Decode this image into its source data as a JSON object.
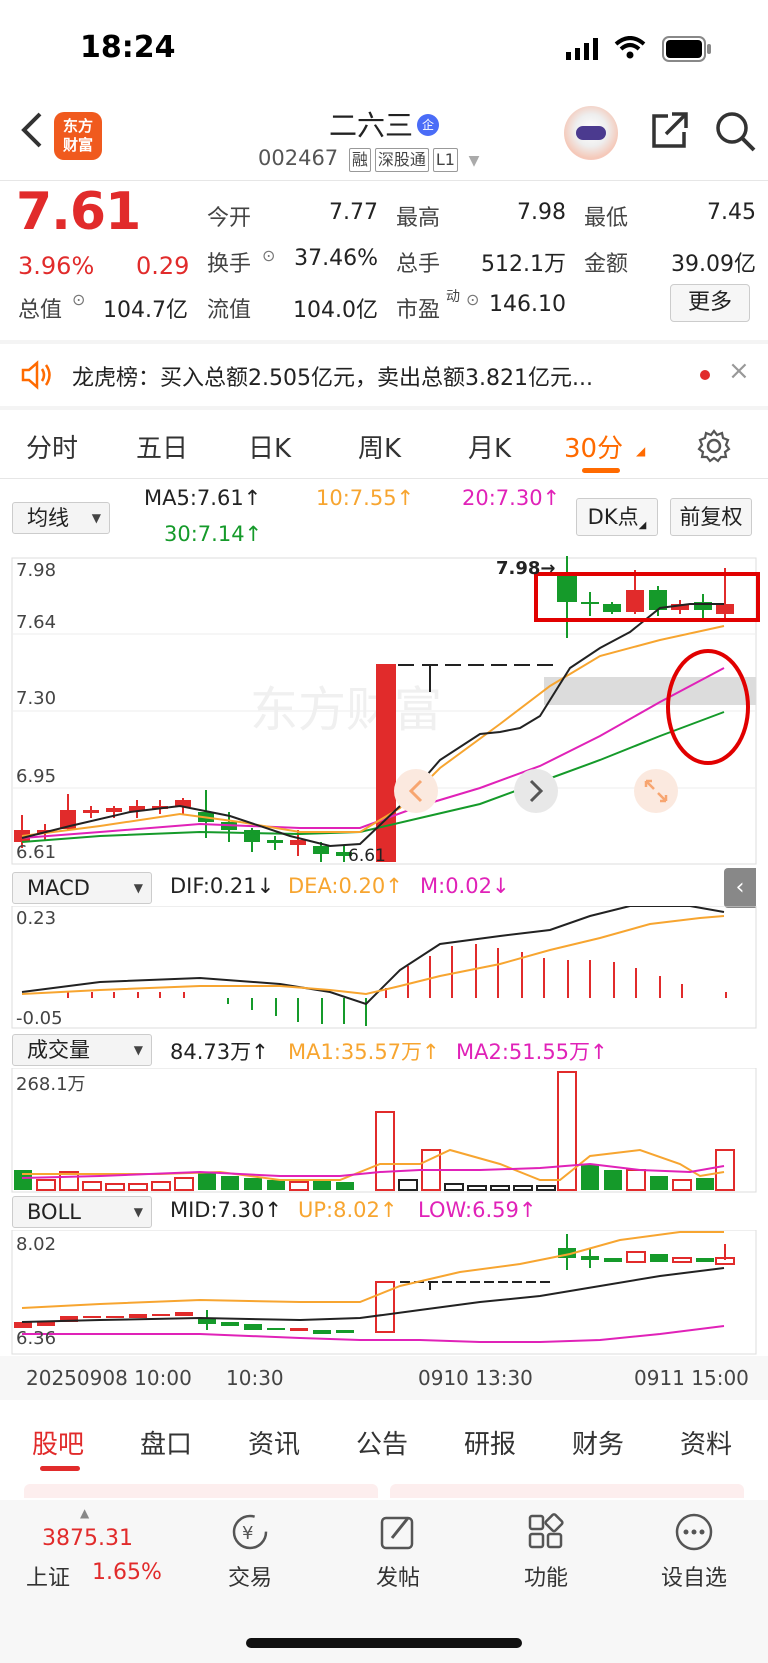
{
  "status": {
    "time": "18:24"
  },
  "header": {
    "logo_text": "东方财富",
    "stock_name": "二六三",
    "badge": "企",
    "code": "002467",
    "tags": [
      "融",
      "深股通",
      "L1"
    ]
  },
  "quote": {
    "price": "7.61",
    "change_pct": "3.96%",
    "change": "0.29",
    "rows": [
      {
        "label": "今开",
        "value": "7.77"
      },
      {
        "label": "最高",
        "value": "7.98"
      },
      {
        "label": "最低",
        "value": "7.45"
      },
      {
        "label": "换手",
        "value": "37.46%"
      },
      {
        "label": "总手",
        "value": "512.1万"
      },
      {
        "label": "金额",
        "value": "39.09亿"
      },
      {
        "label": "总值",
        "value": "104.7亿"
      },
      {
        "label": "流值",
        "value": "104.0亿"
      },
      {
        "label": "市盈",
        "value": "146.10",
        "sup": "动"
      }
    ],
    "more_label": "更多"
  },
  "notice": {
    "text": "龙虎榜：买入总额2.505亿元，卖出总额3.821亿元..."
  },
  "period_tabs": {
    "items": [
      "分时",
      "五日",
      "日K",
      "周K",
      "月K",
      "30分"
    ],
    "active": "30分"
  },
  "chart_toolbar": {
    "ma_select": "均线",
    "ma5": "MA5:7.61↑",
    "ma10": "10:7.55↑",
    "ma20": "20:7.30↑",
    "ma30": "30:7.14↑",
    "dk_button": "DK点",
    "adjust_button": "前复权"
  },
  "main_chart": {
    "y_labels": [
      "7.98",
      "7.64",
      "7.30",
      "6.95",
      "6.61"
    ],
    "high_marker": "7.98→",
    "low_marker": "6.61"
  },
  "macd": {
    "select": "MACD",
    "dif": "DIF:0.21↓",
    "dea": "DEA:0.20↑",
    "m": "M:0.02↓",
    "y_labels": [
      "0.23",
      "-0.05"
    ]
  },
  "volume": {
    "select": "成交量",
    "value": "84.73万↑",
    "ma1": "MA1:35.57万↑",
    "ma2": "MA2:51.55万↑",
    "y_label": "268.1万"
  },
  "boll": {
    "select": "BOLL",
    "mid": "MID:7.30↑",
    "up": "UP:8.02↑",
    "low": "LOW:6.59↑",
    "y_labels": [
      "8.02",
      "6.36"
    ]
  },
  "time_axis": {
    "labels": [
      "20250908 10:00",
      "10:30",
      "0910 13:30",
      "0911 15:00"
    ]
  },
  "info_tabs": {
    "items": [
      "股吧",
      "盘口",
      "资讯",
      "公告",
      "研报",
      "财务",
      "资料"
    ],
    "active": "股吧"
  },
  "bottom_bar": {
    "index_value": "3875.31",
    "index_name": "上证",
    "index_change": "1.65%",
    "items": [
      "交易",
      "发帖",
      "功能",
      "设自选"
    ]
  },
  "colors": {
    "up": "#e12b2b",
    "down": "#159a2a",
    "accent": "#ff6a00",
    "ma10": "#f7a530",
    "ma20": "#e022b8"
  }
}
